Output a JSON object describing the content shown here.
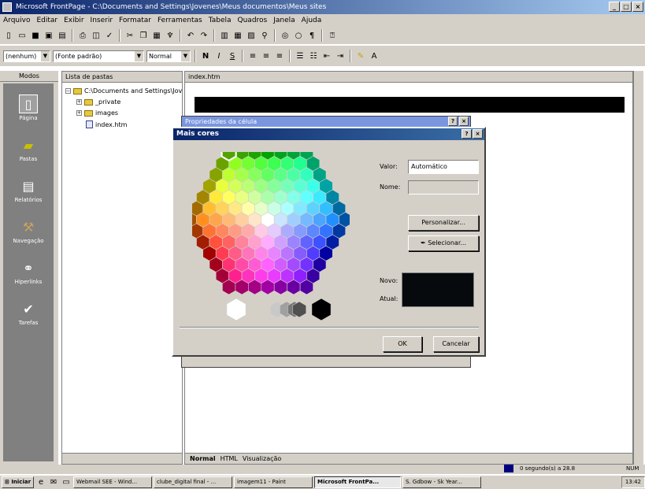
{
  "window": {
    "title": "Microsoft FrontPage - C:\\Documents and Settings\\Jovenes\\Meus documentos\\Meus sites",
    "buttons": [
      "_",
      "□",
      "×"
    ]
  },
  "menu": [
    "Arquivo",
    "Editar",
    "Exibir",
    "Inserir",
    "Formatar",
    "Ferramentas",
    "Tabela",
    "Quadros",
    "Janela",
    "Ajuda"
  ],
  "format_toolbar": {
    "style": "(nenhum)",
    "font": "(Fonte padrão)",
    "size": "Normal",
    "bold": "N",
    "italic": "I",
    "underline": "S"
  },
  "modes": {
    "header": "Modos",
    "items": [
      "Página",
      "Pastas",
      "Relatórios",
      "Navegação",
      "Hiperlinks",
      "Tarefas"
    ]
  },
  "folder_list": {
    "header": "Lista de pastas",
    "root": "C:\\Documents and Settings\\Jov",
    "items": [
      "_private",
      "images",
      "index.htm"
    ]
  },
  "editor": {
    "tab_file": "index.htm",
    "view_tabs": [
      "Normal",
      "HTML",
      "Visualização"
    ]
  },
  "bg_dialog": {
    "title": "Propriedades da célula",
    "buttons": [
      "?",
      "×"
    ]
  },
  "dialog": {
    "title": "Mais cores",
    "buttons": [
      "?",
      "×"
    ],
    "value_label": "Valor:",
    "value": "Automático",
    "name_label": "Nome:",
    "name_value": "",
    "customize_label": "Personalizar...",
    "select_label": "Selecionar...",
    "new_label": "Novo:",
    "current_label": "Atual:",
    "ok_label": "OK",
    "cancel_label": "Cancelar",
    "swatch_color": "#060a0c"
  },
  "status": {
    "text": "0 segundo(s) a 28.8",
    "mode": "NUM"
  },
  "taskbar": {
    "start": "Iniciar",
    "items": [
      "Webmail SEE - Wind...",
      "clube_digital final - ...",
      "imagem11 - Paint",
      "Microsoft FrontPa...",
      "S. Gdbow - Sk Year..."
    ],
    "clock": "13:42"
  }
}
